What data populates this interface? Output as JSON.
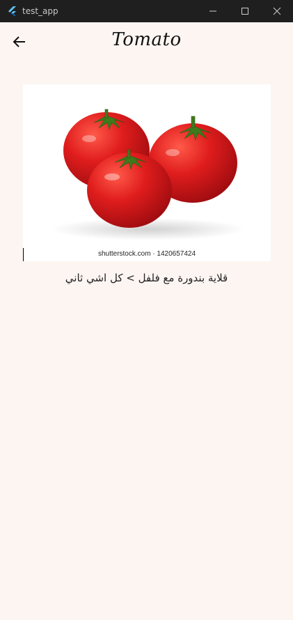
{
  "window": {
    "title": "test_app",
    "icons": [
      "flutter-logo-icon",
      "minimize-icon",
      "maximize-icon",
      "close-icon"
    ]
  },
  "appbar": {
    "title": "Tomato",
    "back_icon": "arrow-left-icon"
  },
  "image": {
    "watermark": "shutterstock.com · 1420657424"
  },
  "content": {
    "caption": "قلاية بندورة مع فلفل > كل اشي ثاني"
  },
  "colors": {
    "background": "#fdf5f2",
    "titlebar": "#1f1f1f",
    "tomato": "#d8161b"
  }
}
